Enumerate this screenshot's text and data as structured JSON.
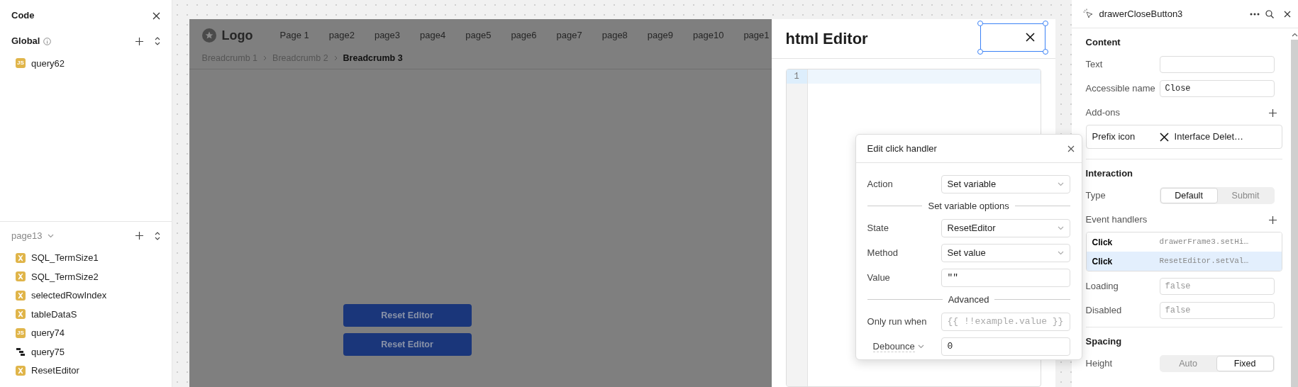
{
  "code_panel": {
    "title": "Code",
    "global": {
      "title": "Global",
      "items": [
        {
          "kind": "js",
          "badge": "JS",
          "name": "query62"
        }
      ]
    },
    "page": {
      "title": "page13",
      "items": [
        {
          "kind": "variable",
          "name": "SQL_TermSize1"
        },
        {
          "kind": "variable",
          "name": "SQL_TermSize2"
        },
        {
          "kind": "variable",
          "name": "selectedRowIndex"
        },
        {
          "kind": "variable",
          "name": "tableDataS"
        },
        {
          "kind": "js",
          "badge": "JS",
          "name": "query74"
        },
        {
          "kind": "workflow",
          "name": "query75"
        },
        {
          "kind": "variable",
          "name": "ResetEditor"
        }
      ]
    }
  },
  "canvas": {
    "logo": "Logo",
    "nav": [
      "Page 1",
      "page2",
      "page3",
      "page4",
      "page5",
      "page6",
      "page7",
      "page8",
      "page9",
      "page10",
      "page1"
    ],
    "breadcrumbs": [
      {
        "label": "Breadcrumb 1",
        "selected": false
      },
      {
        "label": "Breadcrumb 2",
        "selected": false
      },
      {
        "label": "Breadcrumb 3",
        "selected": true
      }
    ],
    "buttons": [
      "Reset Editor",
      "Reset Editor"
    ]
  },
  "drawer": {
    "title": "html Editor",
    "editor": {
      "line_numbers": [
        "1"
      ]
    }
  },
  "popup": {
    "title": "Edit click handler",
    "rows": [
      {
        "kind": "select",
        "label": "Action",
        "value": "Set variable"
      },
      {
        "kind": "section",
        "label": "Set variable options"
      },
      {
        "kind": "select",
        "label": "State",
        "value": "ResetEditor"
      },
      {
        "kind": "select",
        "label": "Method",
        "value": "Set value"
      },
      {
        "kind": "code",
        "label": "Value",
        "value": "\"\""
      },
      {
        "kind": "section",
        "label": "Advanced"
      },
      {
        "kind": "code",
        "label": "Only run when",
        "placeholder": "{{ !!example.value }}"
      },
      {
        "kind": "code",
        "label": "Debounce",
        "value": "0",
        "label_dropdown": true
      }
    ]
  },
  "inspector": {
    "title": "drawerCloseButton3",
    "sections": [
      {
        "title": "Content",
        "rows": [
          {
            "kind": "input",
            "label": "Text"
          },
          {
            "kind": "code",
            "label": "Accessible name",
            "value": "Close"
          },
          {
            "kind": "header",
            "label": "Add-ons"
          },
          {
            "kind": "addon",
            "label": "Prefix icon",
            "value": "Interface Delet…"
          }
        ]
      },
      {
        "title": "Interaction",
        "rows": [
          {
            "kind": "segmented",
            "label": "Type",
            "options": [
              {
                "label": "Default",
                "selected": true
              },
              {
                "label": "Submit",
                "selected": false
              }
            ]
          },
          {
            "kind": "header",
            "label": "Event handlers"
          },
          {
            "kind": "handlers",
            "items": [
              {
                "event": "Click",
                "action": "drawerFrame3.setHi…",
                "selected": false
              },
              {
                "event": "Click",
                "action": "ResetEditor.setVal…",
                "selected": true
              }
            ]
          },
          {
            "kind": "code",
            "label": "Loading",
            "placeholder": "false"
          },
          {
            "kind": "code",
            "label": "Disabled",
            "placeholder": "false"
          }
        ]
      },
      {
        "title": "Spacing",
        "rows": [
          {
            "kind": "segmented",
            "label": "Height",
            "options": [
              {
                "label": "Auto",
                "selected": false
              },
              {
                "label": "Fixed",
                "selected": true
              }
            ]
          }
        ]
      }
    ]
  }
}
